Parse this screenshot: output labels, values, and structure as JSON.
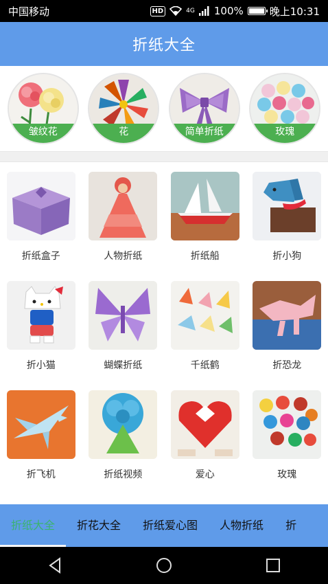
{
  "status": {
    "carrier": "中国移动",
    "hd": "HD",
    "network": "4G",
    "battery": "100%",
    "time": "晚上10:31",
    "battery_level": 1.0
  },
  "appbar": {
    "title": "折纸大全"
  },
  "featured": [
    {
      "label": "皱纹花",
      "icon": "carnation-image"
    },
    {
      "label": "花",
      "icon": "kusudama-flower-image"
    },
    {
      "label": "简单折纸",
      "icon": "paper-bow-image"
    },
    {
      "label": "玫瑰",
      "icon": "paper-roses-image"
    }
  ],
  "grid": [
    {
      "label": "折纸盒子"
    },
    {
      "label": "人物折纸"
    },
    {
      "label": "折纸船"
    },
    {
      "label": "折小狗"
    },
    {
      "label": "折小猫"
    },
    {
      "label": "蝴蝶折纸"
    },
    {
      "label": "千纸鹤"
    },
    {
      "label": "折恐龙"
    },
    {
      "label": "折飞机"
    },
    {
      "label": "折纸视频"
    },
    {
      "label": "爱心"
    },
    {
      "label": "玫瑰"
    }
  ],
  "tabs": [
    "折纸大全",
    "折花大全",
    "折纸爱心图",
    "人物折纸",
    "折"
  ],
  "colors": {
    "appbar": "#5f9be9",
    "accent": "#3cb371",
    "badge": "#4caf50"
  }
}
